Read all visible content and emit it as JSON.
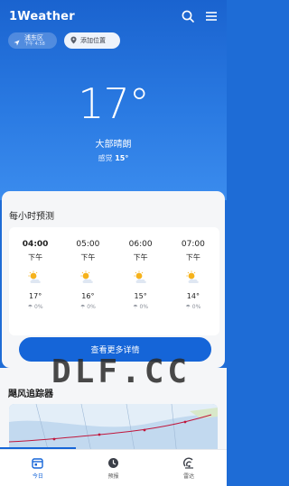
{
  "app": {
    "logo": "1Weather"
  },
  "location": {
    "name": "浦东区",
    "time": "下午 4:58",
    "add_label": "添加位置"
  },
  "current": {
    "temperature": "17°",
    "condition": "大部晴朗",
    "feels_label": "感觉",
    "feels_value": "15°"
  },
  "hourly": {
    "title": "每小时预测",
    "items": [
      {
        "time": "04:00",
        "period": "下午",
        "temp": "17°",
        "precip": "0%",
        "icon": "partly-sunny-icon"
      },
      {
        "time": "05:00",
        "period": "下午",
        "temp": "16°",
        "precip": "0%",
        "icon": "partly-sunny-icon"
      },
      {
        "time": "06:00",
        "period": "下午",
        "temp": "15°",
        "precip": "0%",
        "icon": "partly-sunny-icon"
      },
      {
        "time": "07:00",
        "period": "下午",
        "temp": "14°",
        "precip": "0%",
        "icon": "partly-sunny-icon"
      }
    ],
    "more_button": "查看更多详情"
  },
  "typhoon": {
    "title": "飓风追踪器"
  },
  "watermark": "DLF.CC",
  "tabs": [
    {
      "label": "今日",
      "icon": "calendar-icon",
      "active": true
    },
    {
      "label": "预报",
      "icon": "clock-icon",
      "active": false
    },
    {
      "label": "雷达",
      "icon": "radar-icon",
      "active": false
    }
  ],
  "colors": {
    "accent": "#1565d8",
    "hero_top": "#1a63cf",
    "hero_bottom": "#3b8cee"
  }
}
